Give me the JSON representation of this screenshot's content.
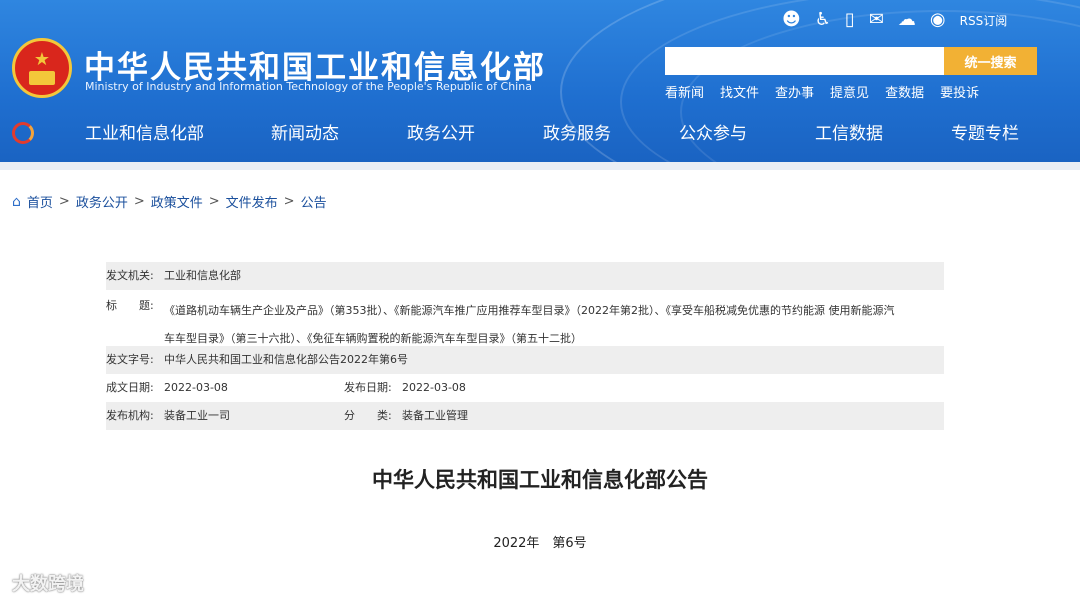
{
  "header": {
    "site_title": "中华人民共和国工业和信息化部",
    "site_subtitle": "Ministry of Industry and Information Technology of the People's Republic of China",
    "rss_label": "RSS订阅",
    "search": {
      "placeholder": "",
      "button_label": "统一搜索"
    },
    "quick_links": [
      "看新闻",
      "找文件",
      "查办事",
      "提意见",
      "查数据",
      "要投诉"
    ],
    "nav": [
      "工业和信息化部",
      "新闻动态",
      "政务公开",
      "政务服务",
      "公众参与",
      "工信数据",
      "专题专栏"
    ]
  },
  "breadcrumb": [
    "首页",
    "政务公开",
    "政策文件",
    "文件发布",
    "公告"
  ],
  "doc_info": {
    "issuer_label": "发文机关:",
    "issuer": "工业和信息化部",
    "title_label": "标　　题:",
    "title_line1": "《道路机动车辆生产企业及产品》（第353批）、《新能源汽车推广应用推荐车型目录》（2022年第2批）、《享受车船税减免优惠的节约能源 使用新能源汽",
    "title_line2": "车车型目录》（第三十六批）、《免征车辆购置税的新能源汽车车型目录》（第五十二批）",
    "doc_no_label": "发文字号:",
    "doc_no": "中华人民共和国工业和信息化部公告2022年第6号",
    "created_label": "成文日期:",
    "created": "2022-03-08",
    "published_label": "发布日期:",
    "published": "2022-03-08",
    "agency_label": "发布机构:",
    "agency": "装备工业一司",
    "category_label": "分　　类:",
    "category": "装备工业管理"
  },
  "document": {
    "heading": "中华人民共和国工业和信息化部公告",
    "number": "2022年　第6号"
  },
  "watermark": "大数跨境",
  "colors": {
    "header_blue": "#1f6fd0",
    "search_button": "#f2b134",
    "breadcrumb_link": "#1a4f9c"
  }
}
